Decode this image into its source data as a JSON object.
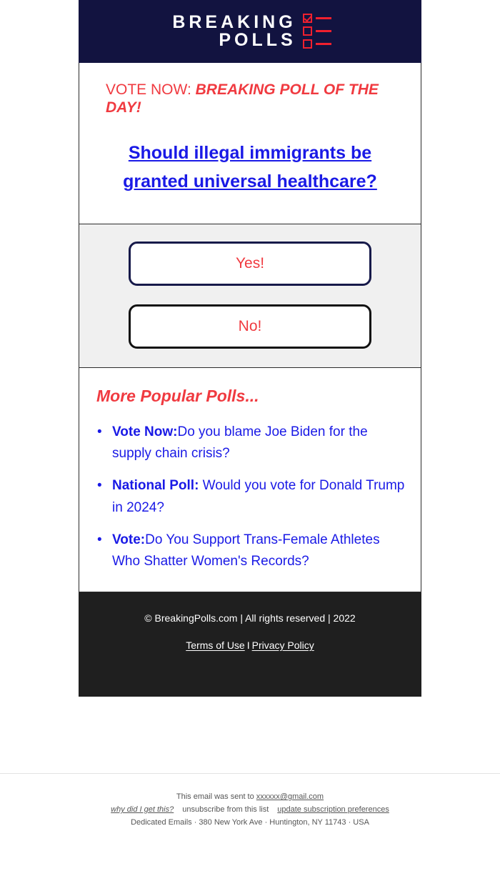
{
  "brand": {
    "logo_line1": "BREAKING",
    "logo_line2": "POLLS",
    "logo_checkbox_icon": "checkbox-checked-icon",
    "header_bg": "#121340",
    "accent_red": "#f03a40",
    "link_blue": "#1a1ae6"
  },
  "poll": {
    "eyebrow_label": "VOTE NOW:",
    "eyebrow_emphasis": "BREAKING POLL OF THE DAY!",
    "question": "Should illegal immigrants be granted universal healthcare?",
    "answers": [
      {
        "label": "Yes!",
        "border_color": "#171a4a"
      },
      {
        "label": "No!",
        "border_color": "#111111"
      }
    ]
  },
  "more_polls": {
    "heading": "More Popular Polls...",
    "items": [
      {
        "label": "Vote Now:",
        "text": "Do you blame Joe Biden for the supply chain crisis?"
      },
      {
        "label": "National Poll:",
        "text": " Would you vote for Donald Trump in 2024?"
      },
      {
        "label": "Vote:",
        "text": "Do You Support Trans-Female Athletes Who Shatter Women's Records?"
      }
    ]
  },
  "footer": {
    "copyright": "© BreakingPolls.com | All rights reserved | 2022",
    "terms_label": "Terms of Use",
    "separator": "I",
    "privacy_label": "Privacy Policy"
  },
  "client_footer": {
    "sent_to_prefix": "This email was sent to ",
    "sent_to_email": "xxxxxx@gmail.com",
    "why_link": "why did I get this?",
    "unsubscribe_link": "unsubscribe from this list",
    "update_link": "update subscription preferences",
    "address": "Dedicated Emails · 380 New York Ave · Huntington, NY 11743 · USA"
  }
}
